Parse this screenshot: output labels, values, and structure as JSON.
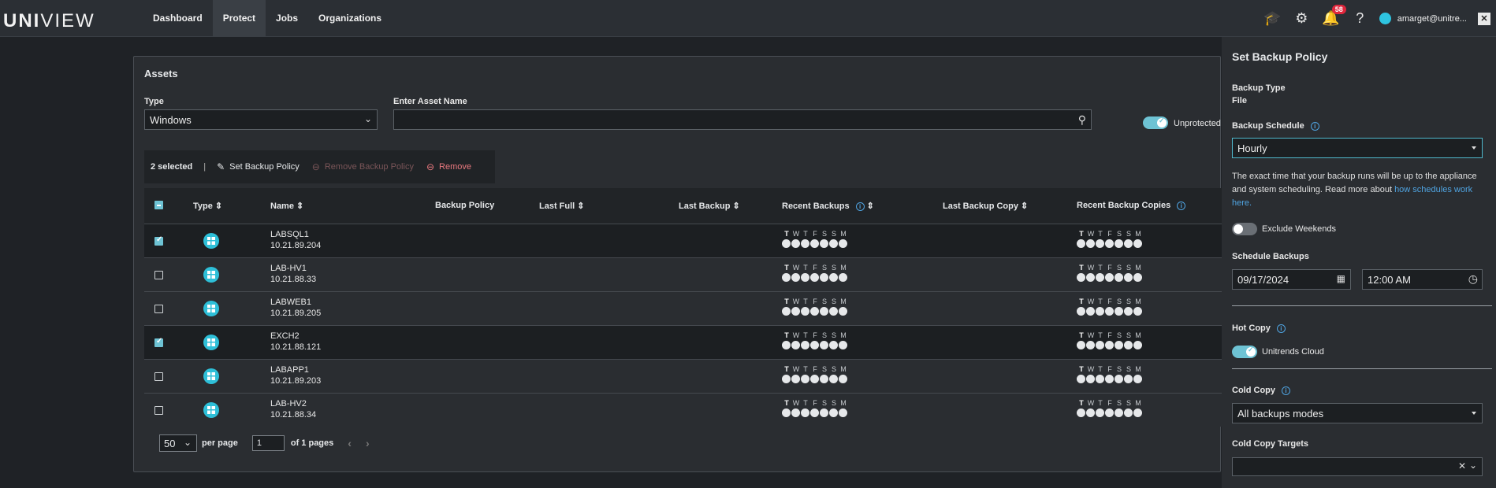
{
  "app": {
    "logo_bold": "UNI",
    "logo_rest": "VIEW",
    "nav": [
      {
        "label": "Dashboard"
      },
      {
        "label": "Protect"
      },
      {
        "label": "Jobs"
      },
      {
        "label": "Organizations"
      }
    ],
    "notification_count": "58",
    "user": "amarget@unitre..."
  },
  "assets": {
    "title": "Assets",
    "type_label": "Type",
    "type_value": "Windows",
    "asset_name_label": "Enter Asset Name",
    "asset_name_value": "",
    "unprotected_label": "Unprotected",
    "selection": {
      "count_text": "2 selected",
      "separator": "|",
      "set_policy": "Set Backup Policy",
      "remove_policy": "Remove Backup Policy",
      "remove": "Remove"
    },
    "columns": {
      "type": "Type",
      "name": "Name",
      "backup_policy": "Backup Policy",
      "last_full": "Last Full",
      "last_backup": "Last Backup",
      "recent_backups": "Recent Backups",
      "last_backup_copy": "Last Backup Copy",
      "recent_backup_copies": "Recent Backup Copies"
    },
    "day_letters": [
      "T",
      "W",
      "T",
      "F",
      "S",
      "S",
      "M"
    ],
    "rows": [
      {
        "name": "LABSQL1",
        "ip": "10.21.89.204",
        "checked": true
      },
      {
        "name": "LAB-HV1",
        "ip": "10.21.88.33",
        "checked": false
      },
      {
        "name": "LABWEB1",
        "ip": "10.21.89.205",
        "checked": false
      },
      {
        "name": "EXCH2",
        "ip": "10.21.88.121",
        "checked": true
      },
      {
        "name": "LABAPP1",
        "ip": "10.21.89.203",
        "checked": false
      },
      {
        "name": "LAB-HV2",
        "ip": "10.21.88.34",
        "checked": false
      }
    ],
    "pager": {
      "per_page_value": "50",
      "per_page_label": "per page",
      "page_value": "1",
      "of_pages": "of 1 pages"
    }
  },
  "panel": {
    "title": "Set Backup Policy",
    "backup_type_label": "Backup Type",
    "backup_type_value": "File",
    "schedule_label": "Backup Schedule",
    "schedule_value": "Hourly",
    "schedule_note": "The exact time that your backup runs will be up to the appliance and system scheduling. Read more about ",
    "schedule_link": "how schedules work here.",
    "exclude_weekends": "Exclude Weekends",
    "schedule_backups_label": "Schedule Backups",
    "date_value": "09/17/2024",
    "time_value": "12:00 AM",
    "hot_copy_label": "Hot Copy",
    "hot_copy_target": "Unitrends Cloud",
    "cold_copy_label": "Cold Copy",
    "cold_copy_value": "All backups modes",
    "cold_copy_targets_label": "Cold Copy Targets"
  },
  "colors": {
    "accent": "#6ec3d4",
    "link": "#4fa3e0",
    "danger": "#e8787e",
    "badge": "#e0263c"
  }
}
